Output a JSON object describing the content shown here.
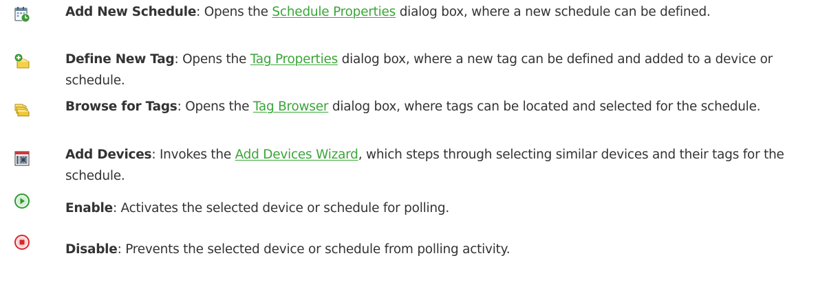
{
  "items": [
    {
      "icon": "add-schedule-icon",
      "term": "Add New Schedule",
      "before": ": Opens the ",
      "link": "Schedule Properties",
      "after": " dialog box, where a new schedule can be defined."
    },
    {
      "icon": "define-tag-icon",
      "term": "Define New Tag",
      "before": ": Opens the ",
      "link": "Tag Properties",
      "after": " dialog box, where a new tag can be defined and added to a device or schedule."
    },
    {
      "icon": "browse-tags-icon",
      "term": "Browse for Tags",
      "before": ": Opens the ",
      "link": "Tag Browser",
      "after": " dialog box, where tags can be located and selected for the schedule."
    },
    {
      "icon": "add-devices-icon",
      "term": "Add Devices",
      "before": ": Invokes the ",
      "link": "Add Devices Wizard",
      "after": ", which steps through selecting similar devices and their tags for the schedule."
    },
    {
      "icon": "enable-icon",
      "term": "Enable",
      "before": ": Activates the selected device or schedule for polling.",
      "link": "",
      "after": ""
    },
    {
      "icon": "disable-icon",
      "term": "Disable",
      "before": ": Prevents the selected device or schedule from polling activity.",
      "link": "",
      "after": ""
    }
  ],
  "colors": {
    "text": "#333333",
    "link": "#3aa538",
    "enable": "#2e9a2e",
    "disable": "#d9262b"
  }
}
